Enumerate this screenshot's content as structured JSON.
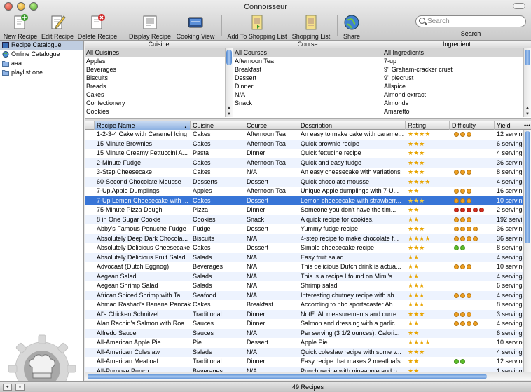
{
  "window": {
    "title": "Connoisseur"
  },
  "toolbar": {
    "new_recipe": "New Recipe",
    "edit_recipe": "Edit Recipe",
    "delete_recipe": "Delete Recipe",
    "display_recipe": "Display Recipe",
    "cooking_view": "Cooking View",
    "add_to_shopping_list": "Add To Shopping List",
    "shopping_list": "Shopping List",
    "share": "Share",
    "search_placeholder": "Search",
    "search_label": "Search"
  },
  "sidebar": {
    "items": [
      {
        "label": "Recipe Catalogue",
        "icon": "catalogue-icon"
      },
      {
        "label": "Online Catalogue",
        "icon": "globe-icon"
      },
      {
        "label": "aaa",
        "icon": "folder-icon"
      },
      {
        "label": "playlist one",
        "icon": "folder-icon"
      }
    ]
  },
  "browser": {
    "cuisine": {
      "header": "Cuisine",
      "items": [
        "All Cuisines",
        "Apples",
        "Beverages",
        "Biscuits",
        "Breads",
        "Cakes",
        "Confectionery",
        "Cookies"
      ]
    },
    "course": {
      "header": "Course",
      "items": [
        "All Courses",
        "Afternoon Tea",
        "Breakfast",
        "Dessert",
        "Dinner",
        "N/A",
        "Snack"
      ]
    },
    "ingredient": {
      "header": "Ingredient",
      "items": [
        "All Ingredients",
        "7-up",
        "9\" Graham-cracker crust",
        "9\" piecrust",
        "Allspice",
        "Almond extract",
        "Almonds",
        "Amaretto"
      ]
    }
  },
  "table": {
    "columns": [
      "Recipe Name",
      "Cuisine",
      "Course",
      "Description",
      "Rating",
      "Difficulty",
      "Yield"
    ],
    "rows": [
      {
        "name": "1-2-3-4 Cake with Caramel Icing",
        "cuisine": "Cakes",
        "course": "Afternoon Tea",
        "desc": "An easy to make cake with carame...",
        "rating": 4,
        "difficulty": [
          "o",
          "o",
          "o"
        ],
        "yield": "12 servings"
      },
      {
        "name": "15 Minute Brownies",
        "cuisine": "Cakes",
        "course": "Afternoon Tea",
        "desc": "Quick brownie recipe",
        "rating": 3,
        "difficulty": [],
        "yield": "6 servings"
      },
      {
        "name": "15 Minute Creamy Fettuccini A...",
        "cuisine": "Pasta",
        "course": "Dinner",
        "desc": "Quick fettucine recipe",
        "rating": 3,
        "difficulty": [],
        "yield": "4 servings"
      },
      {
        "name": "2-Minute Fudge",
        "cuisine": "Cakes",
        "course": "Afternoon Tea",
        "desc": "Quick and easy fudge",
        "rating": 3,
        "difficulty": [],
        "yield": "36 servings"
      },
      {
        "name": "3-Step Cheesecake",
        "cuisine": "Cakes",
        "course": "N/A",
        "desc": "An easy cheesecake with variations",
        "rating": 3,
        "difficulty": [
          "o",
          "o",
          "o"
        ],
        "yield": "8 servings"
      },
      {
        "name": "60-Second Chocolate Mousse",
        "cuisine": "Desserts",
        "course": "Dessert",
        "desc": "Quick chocolate mousse",
        "rating": 4,
        "difficulty": [],
        "yield": "4 servings"
      },
      {
        "name": "7-Up Apple Dumplings",
        "cuisine": "Apples",
        "course": "Afternoon Tea",
        "desc": "Unique Apple dumplings with 7-U...",
        "rating": 2,
        "difficulty": [
          "o",
          "o",
          "o"
        ],
        "yield": "16 servings"
      },
      {
        "name": "7-Up Lemon Cheesecake with ...",
        "cuisine": "Cakes",
        "course": "Dessert",
        "desc": "Lemon cheesecake with strawberr...",
        "rating": 3,
        "difficulty": [
          "o",
          "o",
          "o"
        ],
        "yield": "10 servings",
        "selected": true
      },
      {
        "name": "75-Minute Pizza Dough",
        "cuisine": "Pizza",
        "course": "Dinner",
        "desc": "Someone you don't have the tim...",
        "rating": 2,
        "difficulty": [
          "r",
          "r",
          "r",
          "r",
          "r"
        ],
        "yield": "2 servings"
      },
      {
        "name": "8 in One Sugar Cookie",
        "cuisine": "Cookies",
        "course": "Snack",
        "desc": "A quick recipe for cookies.",
        "rating": 2,
        "difficulty": [
          "o",
          "o",
          "o"
        ],
        "yield": "192 servings"
      },
      {
        "name": "Abby's Famous Penuche Fudge",
        "cuisine": "Fudge",
        "course": "Dessert",
        "desc": "Yummy fudge recipe",
        "rating": 3,
        "difficulty": [
          "o",
          "o",
          "o",
          "o"
        ],
        "yield": "36 servings"
      },
      {
        "name": "Absolutely Deep Dark Chocola...",
        "cuisine": "Biscuits",
        "course": "N/A",
        "desc": "4-step recipe to make chocolate f...",
        "rating": 4,
        "difficulty": [
          "o",
          "o",
          "o",
          "o"
        ],
        "yield": "36 servings"
      },
      {
        "name": "Absolutely Delicious Cheesecake",
        "cuisine": "Cakes",
        "course": "Dessert",
        "desc": "Simple cheesecake recipe",
        "rating": 3,
        "difficulty": [
          "g",
          "g"
        ],
        "yield": "8 servings"
      },
      {
        "name": "Absolutely Delicious Fruit Salad",
        "cuisine": "Salads",
        "course": "N/A",
        "desc": "Easy fruit salad",
        "rating": 2,
        "difficulty": [],
        "yield": "4 servings"
      },
      {
        "name": "Advocaat (Dutch Eggnog)",
        "cuisine": "Beverages",
        "course": "N/A",
        "desc": "This delicious Dutch drink is actua...",
        "rating": 2,
        "difficulty": [
          "o",
          "o",
          "o"
        ],
        "yield": "10 servings"
      },
      {
        "name": "Aegean Salad",
        "cuisine": "Salads",
        "course": "N/A",
        "desc": "This is a recipe I found on Mimi's ...",
        "rating": 2,
        "difficulty": [],
        "yield": "4 servings"
      },
      {
        "name": "Aegean Shrimp Salad",
        "cuisine": "Salads",
        "course": "N/A",
        "desc": "Shrimp salad",
        "rating": 3,
        "difficulty": [],
        "yield": "6 servings"
      },
      {
        "name": "African Spiced Shrimp with Ta...",
        "cuisine": "Seafood",
        "course": "N/A",
        "desc": "Interesting chutney recipe with sh...",
        "rating": 3,
        "difficulty": [
          "o",
          "o",
          "o"
        ],
        "yield": "4 servings"
      },
      {
        "name": "Ahmad Rashad's Banana Pancakes",
        "cuisine": "Cakes",
        "course": "Breakfast",
        "desc": "According to nbc sportscaster Ah...",
        "rating": 3,
        "difficulty": [],
        "yield": "8 servings"
      },
      {
        "name": "Al's Chicken Schnitzel",
        "cuisine": "Traditional",
        "course": "Dinner",
        "desc": "NotE: All measurements and curre...",
        "rating": 3,
        "difficulty": [
          "o",
          "o",
          "o"
        ],
        "yield": "3 servings"
      },
      {
        "name": "Alan Rachin's Salmon with Roa...",
        "cuisine": "Sauces",
        "course": "Dinner",
        "desc": "Salmon and dressing with a garlic ...",
        "rating": 2,
        "difficulty": [
          "o",
          "o",
          "o",
          "o"
        ],
        "yield": "4 servings"
      },
      {
        "name": "Alfredo Sauce",
        "cuisine": "Sauces",
        "course": "N/A",
        "desc": "Per serving (3 1/2 ounces): Calori...",
        "rating": 2,
        "difficulty": [],
        "yield": "6 servings"
      },
      {
        "name": "All-American Apple Pie",
        "cuisine": "Pie",
        "course": "Dessert",
        "desc": "Apple Pie",
        "rating": 4,
        "difficulty": [],
        "yield": "10 servings"
      },
      {
        "name": "All-American Coleslaw",
        "cuisine": "Salads",
        "course": "N/A",
        "desc": "Quick coleslaw recipe with some v...",
        "rating": 3,
        "difficulty": [],
        "yield": "4 servings"
      },
      {
        "name": "All-American Meatloaf",
        "cuisine": "Traditional",
        "course": "Dinner",
        "desc": "Easy recipe that makes 2 meatloafs",
        "rating": 2,
        "difficulty": [
          "g",
          "g"
        ],
        "yield": "12 servings"
      },
      {
        "name": "All-Purpose Punch",
        "cuisine": "Beverages",
        "course": "N/A",
        "desc": "Punch recipe with pineapple and o...",
        "rating": 2,
        "difficulty": [],
        "yield": "1 servings"
      }
    ]
  },
  "status": {
    "count": "49 Recipes"
  },
  "colors": {
    "selection": "#3875d7",
    "alt_row": "#edf3fe",
    "star": "#e8a400",
    "diff_orange": "#f0a020",
    "diff_red": "#d22a1a",
    "diff_green": "#5cbf2a"
  }
}
